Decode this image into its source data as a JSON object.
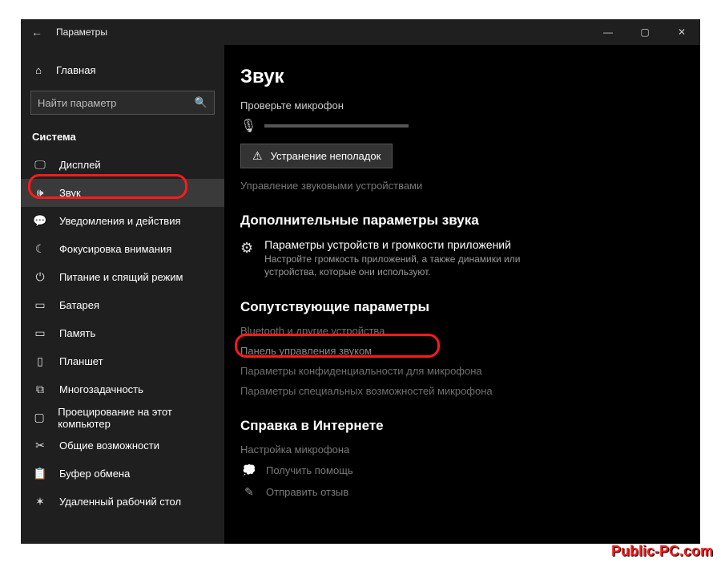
{
  "titlebar": {
    "back": "←",
    "title": "Параметры"
  },
  "sidebar": {
    "home": "Главная",
    "search_placeholder": "Найти параметр",
    "section": "Система",
    "items": [
      {
        "icon": "display",
        "label": "Дисплей"
      },
      {
        "icon": "sound",
        "label": "Звук",
        "selected": true
      },
      {
        "icon": "notify",
        "label": "Уведомления и действия"
      },
      {
        "icon": "focus",
        "label": "Фокусировка внимания"
      },
      {
        "icon": "power",
        "label": "Питание и спящий режим"
      },
      {
        "icon": "battery",
        "label": "Батарея"
      },
      {
        "icon": "storage",
        "label": "Память"
      },
      {
        "icon": "tablet",
        "label": "Планшет"
      },
      {
        "icon": "multitask",
        "label": "Многозадачность"
      },
      {
        "icon": "project",
        "label": "Проецирование на этот компьютер"
      },
      {
        "icon": "shared",
        "label": "Общие возможности"
      },
      {
        "icon": "clipboard",
        "label": "Буфер обмена"
      },
      {
        "icon": "remote",
        "label": "Удаленный рабочий стол"
      }
    ]
  },
  "main": {
    "title": "Звук",
    "mic_check": "Проверьте микрофон",
    "troubleshoot": "Устранение неполадок",
    "manage_devices": "Управление звуковыми устройствами",
    "advanced": {
      "heading": "Дополнительные параметры звука",
      "mixer_title": "Параметры устройств и громкости приложений",
      "mixer_desc": "Настройте громкость приложений, а также динамики или устройства, которые они используют."
    },
    "related": {
      "heading": "Сопутствующие параметры",
      "links": [
        "Bluetooth и другие устройства",
        "Панель управления звуком",
        "Параметры конфиденциальности для микрофона",
        "Параметры специальных возможностей микрофона"
      ]
    },
    "web_help": {
      "heading": "Справка в Интернете",
      "link": "Настройка микрофона"
    },
    "footer": {
      "get_help": "Получить помощь",
      "feedback": "Отправить отзыв"
    }
  },
  "watermark": "Public-PC.com"
}
